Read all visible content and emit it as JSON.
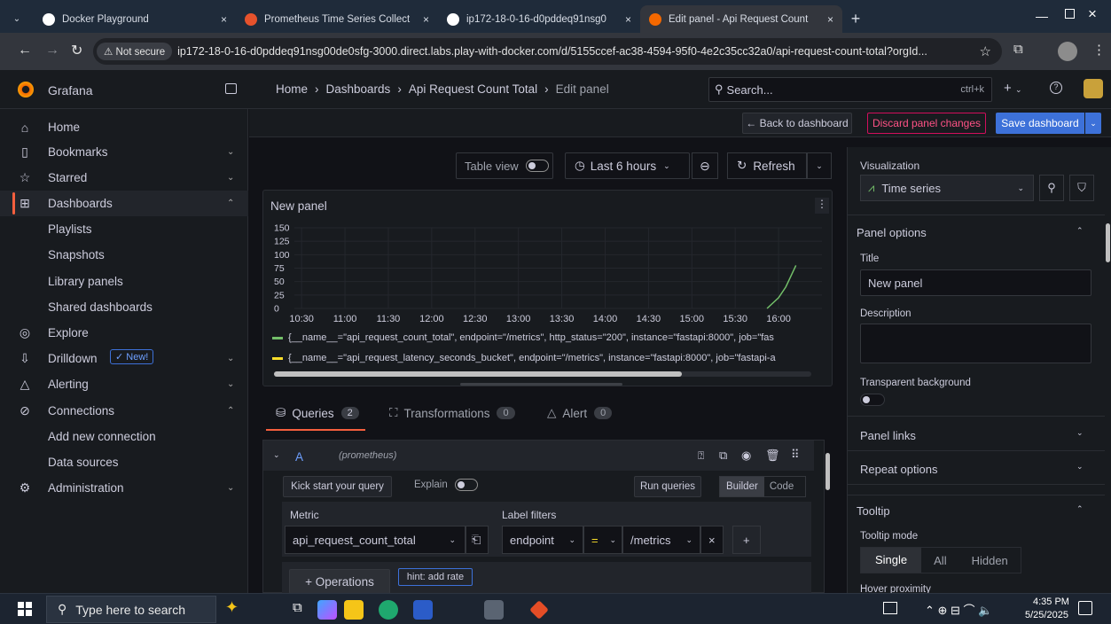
{
  "browser": {
    "tabs": [
      {
        "title": "Docker Playground",
        "close": "×",
        "icon_color": "#ffffff"
      },
      {
        "title": "Prometheus Time Series Collect",
        "close": "×",
        "icon_color": "#e6522c"
      },
      {
        "title": "ip172-18-0-16-d0pddeq91nsg0",
        "close": "×",
        "icon_color": "#ffffff"
      },
      {
        "title": "Edit panel - Api Request Count",
        "close": "×",
        "icon_color": "#f46800"
      }
    ],
    "new_tab": "+",
    "not_secure": "Not secure",
    "url": "ip172-18-0-16-d0pddeq91nsg00de0sfg-3000.direct.labs.play-with-docker.com/d/5155ccef-ac38-4594-95f0-4e2c35cc32a0/api-request-count-total?orgId..."
  },
  "grafana": {
    "brand": "Grafana",
    "breadcrumb": [
      "Home",
      "Dashboards",
      "Api Request Count Total",
      "Edit panel"
    ],
    "search_placeholder": "Search...",
    "search_shortcut": "ctrl+k",
    "plus": "+",
    "help": "?"
  },
  "sidebar": {
    "items": [
      {
        "label": "Home",
        "icon": "home-icon"
      },
      {
        "label": "Bookmarks",
        "icon": "bookmark-icon",
        "chevron": "⌄"
      },
      {
        "label": "Starred",
        "icon": "star-icon",
        "chevron": "⌄"
      },
      {
        "label": "Dashboards",
        "icon": "dashboards-icon",
        "chevron": "⌃"
      },
      {
        "label": "Playlists"
      },
      {
        "label": "Snapshots"
      },
      {
        "label": "Library panels"
      },
      {
        "label": "Shared dashboards"
      },
      {
        "label": "Explore",
        "icon": "compass-icon"
      },
      {
        "label": "Drilldown",
        "icon": "drilldown-icon",
        "chevron": "⌄",
        "badge": "New!"
      },
      {
        "label": "Alerting",
        "icon": "bell-icon",
        "chevron": "⌄"
      },
      {
        "label": "Connections",
        "icon": "connections-icon",
        "chevron": "⌃"
      },
      {
        "label": "Add new connection"
      },
      {
        "label": "Data sources"
      },
      {
        "label": "Administration",
        "icon": "gear-icon",
        "chevron": "⌄"
      }
    ]
  },
  "toolbar": {
    "back": "← Back to dashboard",
    "discard": "Discard panel changes",
    "save": "Save dashboard",
    "table_view": "Table view",
    "time_range": "Last 6 hours",
    "refresh": "Refresh"
  },
  "panel": {
    "title": "New panel",
    "legend": [
      {
        "text": "{__name__=\"api_request_count_total\", endpoint=\"/metrics\", http_status=\"200\", instance=\"fastapi:8000\", job=\"fas",
        "color": "#73bf69"
      },
      {
        "text": "{__name__=\"api_request_latency_seconds_bucket\", endpoint=\"/metrics\", instance=\"fastapi:8000\", job=\"fastapi-a",
        "color": "#fade2a"
      }
    ]
  },
  "chart_data": {
    "type": "line",
    "x_ticks": [
      "10:30",
      "11:00",
      "11:30",
      "12:00",
      "12:30",
      "13:00",
      "13:30",
      "14:00",
      "14:30",
      "15:00",
      "15:30",
      "16:00"
    ],
    "y_ticks": [
      "150",
      "125",
      "100",
      "75",
      "50",
      "25",
      "0"
    ],
    "ylim": [
      0,
      150
    ],
    "series": [
      {
        "color": "#73bf69",
        "x": [
          "15:52",
          "16:00",
          "16:05",
          "16:12"
        ],
        "values": [
          0,
          20,
          40,
          80
        ]
      },
      {
        "color": "#fade2a",
        "x": [],
        "values": []
      }
    ]
  },
  "tabs": {
    "queries": {
      "label": "Queries",
      "count": "2"
    },
    "transformations": {
      "label": "Transformations",
      "count": "0"
    },
    "alert": {
      "label": "Alert",
      "count": "0"
    }
  },
  "query": {
    "ref": "A",
    "datasource": "(prometheus)",
    "kick_start": "Kick start your query",
    "explain": "Explain",
    "run": "Run queries",
    "builder": "Builder",
    "code": "Code",
    "metric_label": "Metric",
    "metric_value": "api_request_count_total",
    "label_filters": "Label filters",
    "filter_key": "endpoint",
    "filter_op": "=",
    "filter_value": "/metrics",
    "operations": "+ Operations",
    "hint": "hint: add rate"
  },
  "options": {
    "visualization_label": "Visualization",
    "visualization": "Time series",
    "panel_options": "Panel options",
    "title_label": "Title",
    "title_value": "New panel",
    "description_label": "Description",
    "transparent": "Transparent background",
    "panel_links": "Panel links",
    "repeat_options": "Repeat options",
    "tooltip": "Tooltip",
    "tooltip_mode": "Tooltip mode",
    "modes": [
      "Single",
      "All",
      "Hidden"
    ],
    "hover": "Hover proximity"
  },
  "taskbar": {
    "search": "Type here to search",
    "time": "4:35 PM",
    "date": "5/25/2025"
  }
}
